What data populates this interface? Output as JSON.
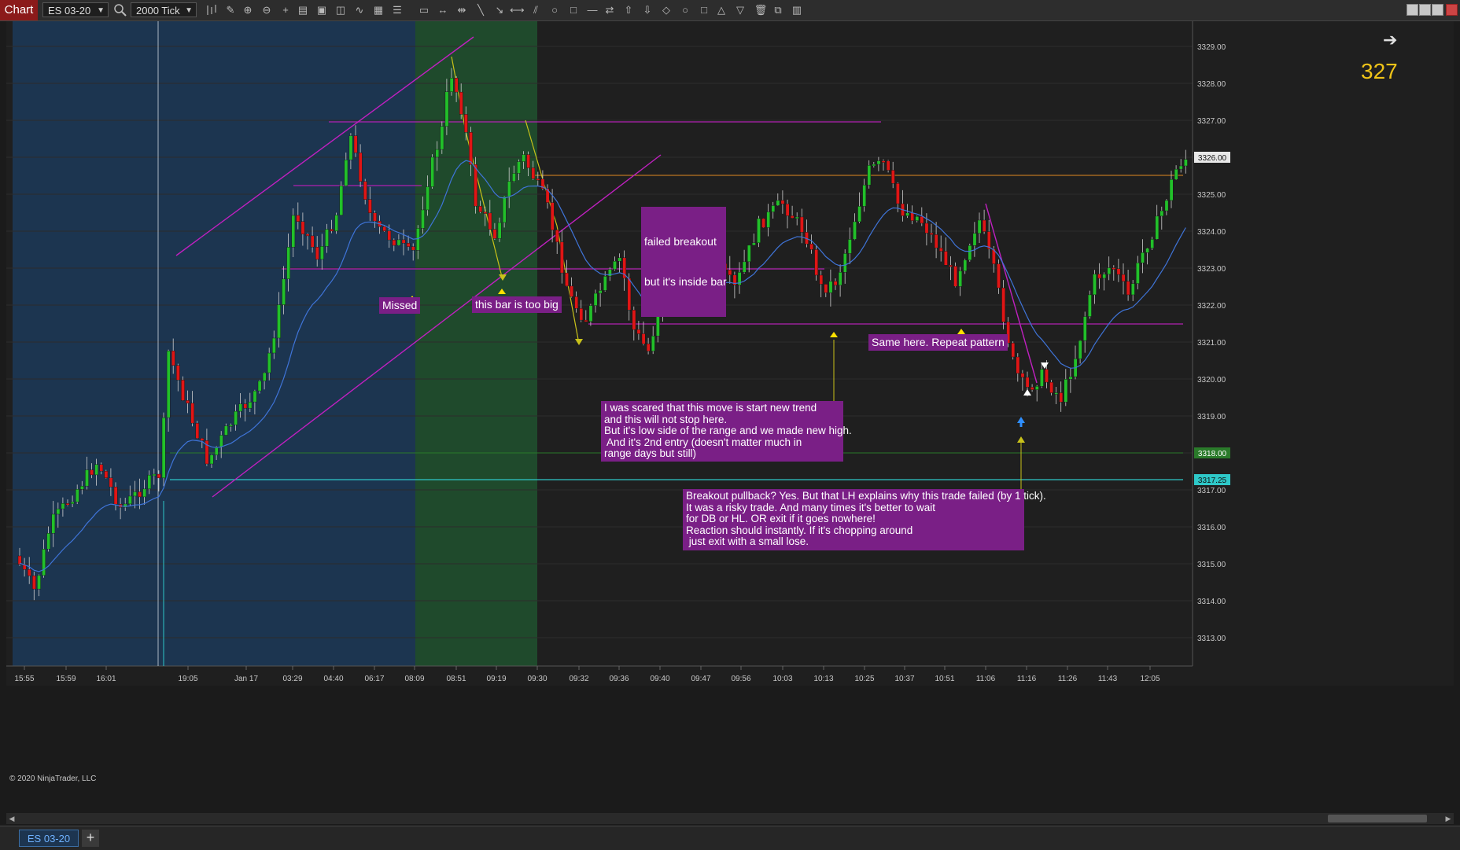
{
  "toolbar": {
    "chart_label": "Chart",
    "instrument": "ES 03-20",
    "bar_type": "2000 Tick"
  },
  "chart": {
    "instrument_tab": "ES 03-20",
    "copyright": "© 2020 NinjaTrader, LLC",
    "bar_counter": "327",
    "price_labels": [
      "3329.00",
      "3328.00",
      "3327.00",
      "3326.00",
      "3325.00",
      "3324.00",
      "3323.00",
      "3322.00",
      "3321.00",
      "3320.00",
      "3319.00",
      "3318.00",
      "3317.25",
      "3317.00",
      "3316.00",
      "3315.00",
      "3314.00",
      "3313.00"
    ],
    "current_price_tag": "3326.00",
    "level_tag_green": "3318.00",
    "level_tag_cyan": "3317.25",
    "time_labels": [
      "15:55",
      "15:59",
      "16:01",
      "19:05",
      "Jan 17",
      "03:29",
      "04:40",
      "06:17",
      "08:09",
      "08:51",
      "09:19",
      "09:30",
      "09:32",
      "09:36",
      "09:40",
      "09:47",
      "09:56",
      "10:03",
      "10:13",
      "10:25",
      "10:37",
      "10:51",
      "11:06",
      "11:16",
      "11:26",
      "11:43",
      "12:05"
    ],
    "colors": {
      "background": "#1f1f1f",
      "overnight_shade": "#1c3550",
      "open_shade": "#1f4a2c",
      "up_candle": "#22c02a",
      "down_candle": "#e01515",
      "ema": "#3f74d8",
      "annotation": "#7a1f86",
      "trendline": "#c020c0"
    }
  },
  "annotations": {
    "missed": "Missed",
    "too_big": "this bar is too big",
    "failed_breakout_1": "failed breakout",
    "failed_breakout_2": "but it's inside bar",
    "same_here": "Same here. Repeat pattern",
    "scared": "I was scared that this move is start new trend\nand this will not stop here.\nBut it's low side of the range and we made new high.\n And it's 2nd entry (doesn't matter much in\nrange days but still)",
    "breakout_pullback": "Breakout pullback? Yes. But that LH explains why this trade failed (by 1 tick).\nIt was a risky trade. And many times it's better to wait\nfor DB or HL. OR exit if it goes nowhere!\nReaction should instantly. If it's chopping around\n just exit with a small lose."
  }
}
